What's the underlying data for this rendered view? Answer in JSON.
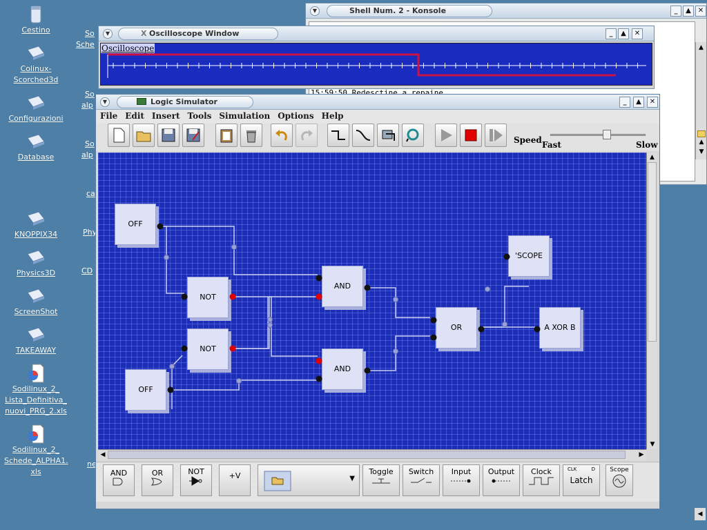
{
  "desktop": {
    "icons": [
      {
        "label": "Cestino",
        "icon": "trash-icon"
      },
      {
        "label": "Colinux-Scorched3d",
        "icon": "shortcut-icon"
      },
      {
        "label": "Configurazioni",
        "icon": "shortcut-icon"
      },
      {
        "label": "Database",
        "icon": "shortcut-icon"
      },
      {
        "label": "KNOPPIX34",
        "icon": "shortcut-icon"
      },
      {
        "label": "Physics3D",
        "icon": "shortcut-icon"
      },
      {
        "label": "ScreenShot",
        "icon": "shortcut-icon"
      },
      {
        "label": "TAKEAWAY",
        "icon": "shortcut-icon"
      },
      {
        "label": "Sodilinux_2_ Lista_Definitiva_ nuovi_PRG_2.xls",
        "icon": "spreadsheet-icon"
      },
      {
        "label": "Sodilinux_2_ Schede_ALPHA1. xls",
        "icon": "spreadsheet-icon"
      }
    ],
    "partial_labels": [
      "So",
      "Sche",
      "So",
      "alp",
      "So",
      "alp",
      "ca",
      "Phy",
      "CD",
      "ne"
    ]
  },
  "konsole": {
    "title": "Shell Num. 2 - Konsole",
    "text": "15:59:50 Redesctine a repaine"
  },
  "oscilloscope": {
    "title": "Oscilloscope Window",
    "label": "Oscilloscope",
    "signal_color": "#cc1144",
    "trace_color": "#ffffff"
  },
  "logic": {
    "title": "Logic Simulator",
    "menu": [
      "File",
      "Edit",
      "Insert",
      "Tools",
      "Simulation",
      "Options",
      "Help"
    ],
    "speed": {
      "label": "Speed",
      "fast": "Fast",
      "slow": "Slow",
      "value": 0.6
    },
    "gates": [
      {
        "id": "off1",
        "label": "OFF"
      },
      {
        "id": "not1",
        "label": "NOT"
      },
      {
        "id": "not2",
        "label": "NOT"
      },
      {
        "id": "off2",
        "label": "OFF"
      },
      {
        "id": "and1",
        "label": "AND"
      },
      {
        "id": "and2",
        "label": "AND"
      },
      {
        "id": "or1",
        "label": "OR"
      },
      {
        "id": "scope",
        "label": "'SCOPE"
      },
      {
        "id": "xor",
        "label": "A XOR B"
      }
    ],
    "palette": [
      "AND",
      "OR",
      "NOT",
      "+V",
      "Toggle",
      "Switch",
      "Input",
      "Output",
      "Clock",
      "Latch",
      "Scope"
    ],
    "latch_clk": "CLK",
    "latch_d": "D",
    "colors": {
      "canvas": "#1c2eb8",
      "gate": "#dfe2f6",
      "wire": "#c8ccf0",
      "pin_high": "#e00000",
      "pin_low": "#111111"
    }
  }
}
